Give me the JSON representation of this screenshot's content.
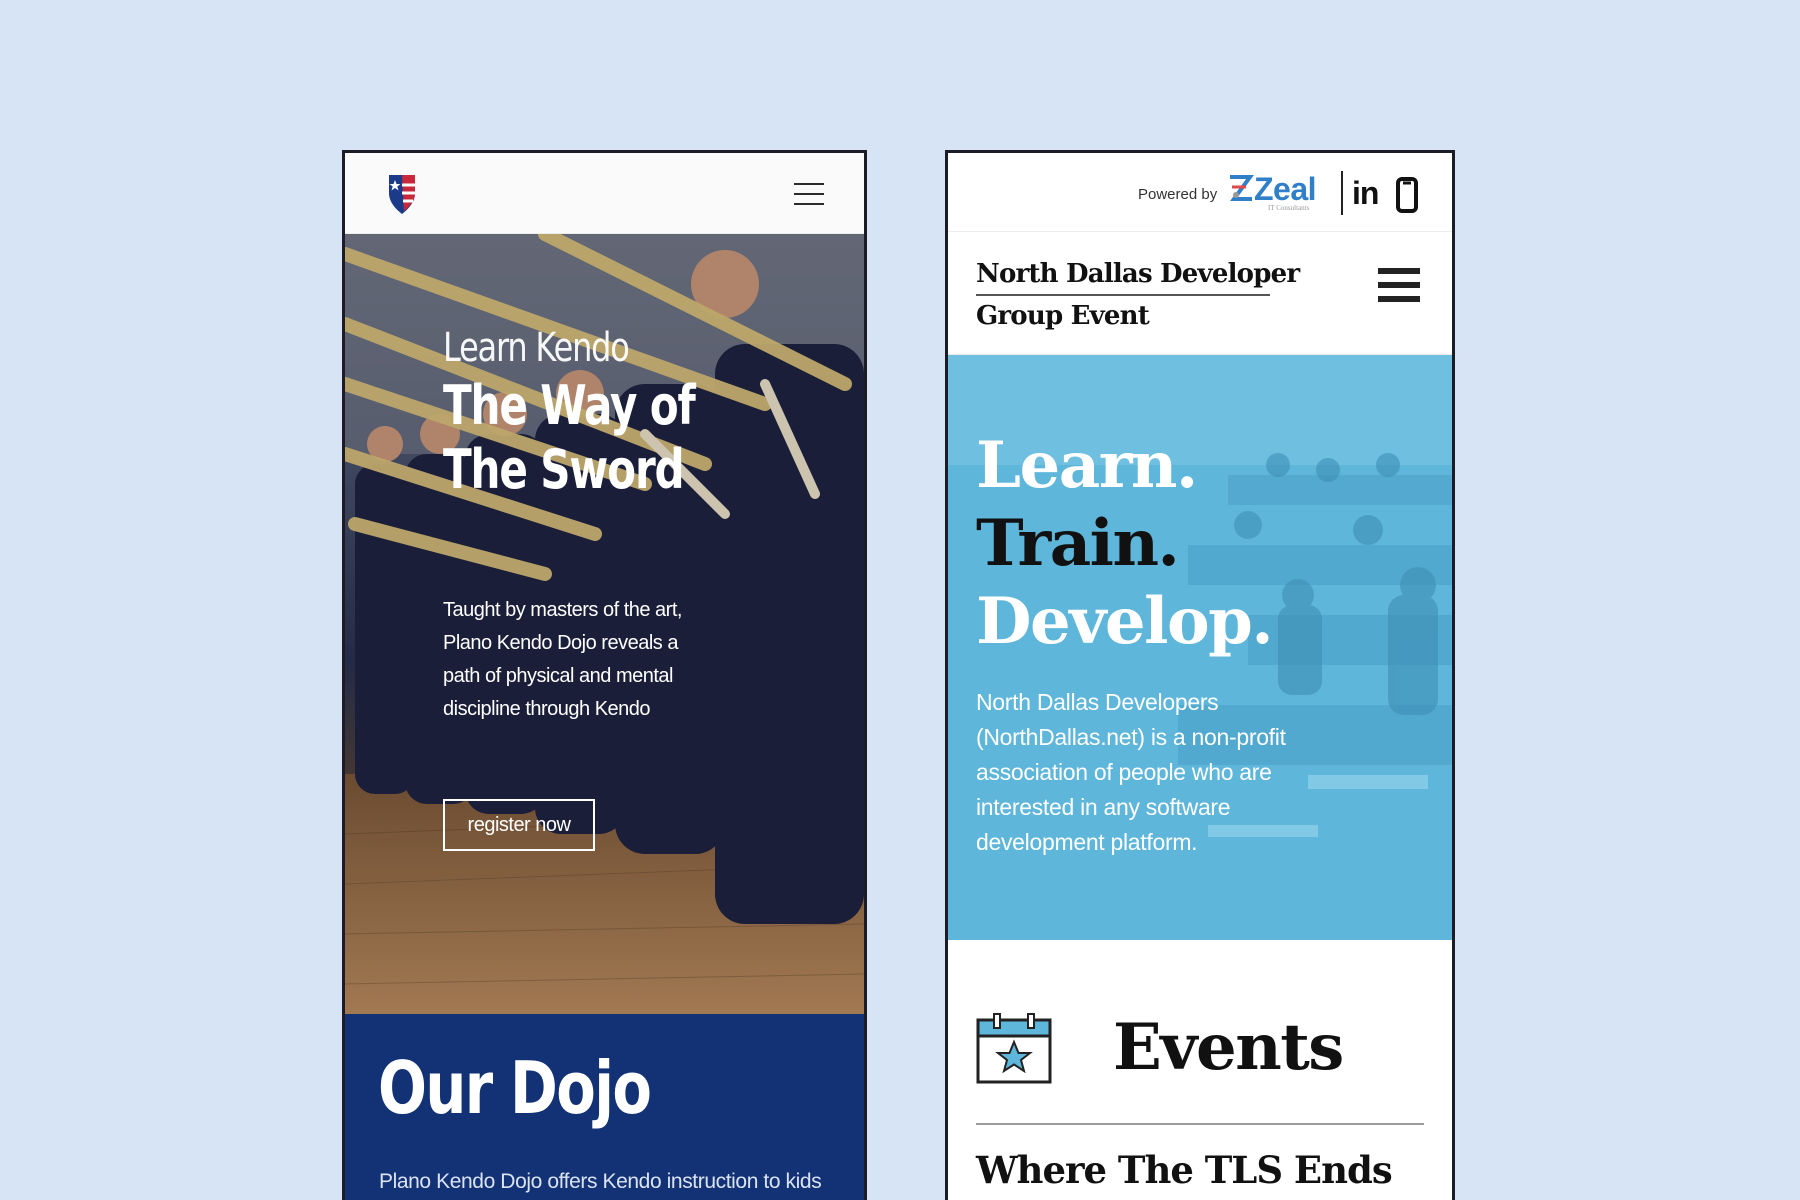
{
  "kendo": {
    "menu_icon": "hamburger-icon",
    "logo_icon": "shield-flag-icon",
    "hero": {
      "kicker": "Learn Kendo",
      "title_line1": "The Way of",
      "title_line2": "The Sword",
      "description": "Taught by masters of the art, Plano Kendo Dojo reveals a path of physical and mental discipline through Kendo",
      "button_label": "register now"
    },
    "dojo": {
      "heading": "Our Dojo",
      "text": "Plano Kendo Dojo offers Kendo instruction to kids"
    },
    "colors": {
      "dojo_bg": "#123275"
    }
  },
  "ndd": {
    "powered_label": "Powered by",
    "zeal_brand": "Zeal",
    "zeal_sub": "IT Consultants",
    "linkedin_label": "in",
    "site_title_line1": "North Dallas Developer",
    "site_title_line2": "Group Event",
    "hero": {
      "word1": "Learn.",
      "word2": "Train.",
      "word3": "Develop.",
      "description": "North Dallas Developers (NorthDallas.net) is a non-profit association of people who are interested in any software development platform."
    },
    "events": {
      "heading": "Events",
      "subheading": "Where The TLS Ends"
    },
    "colors": {
      "hero_overlay": "#5eb6db",
      "zeal_blue": "#2f7fc9"
    }
  }
}
